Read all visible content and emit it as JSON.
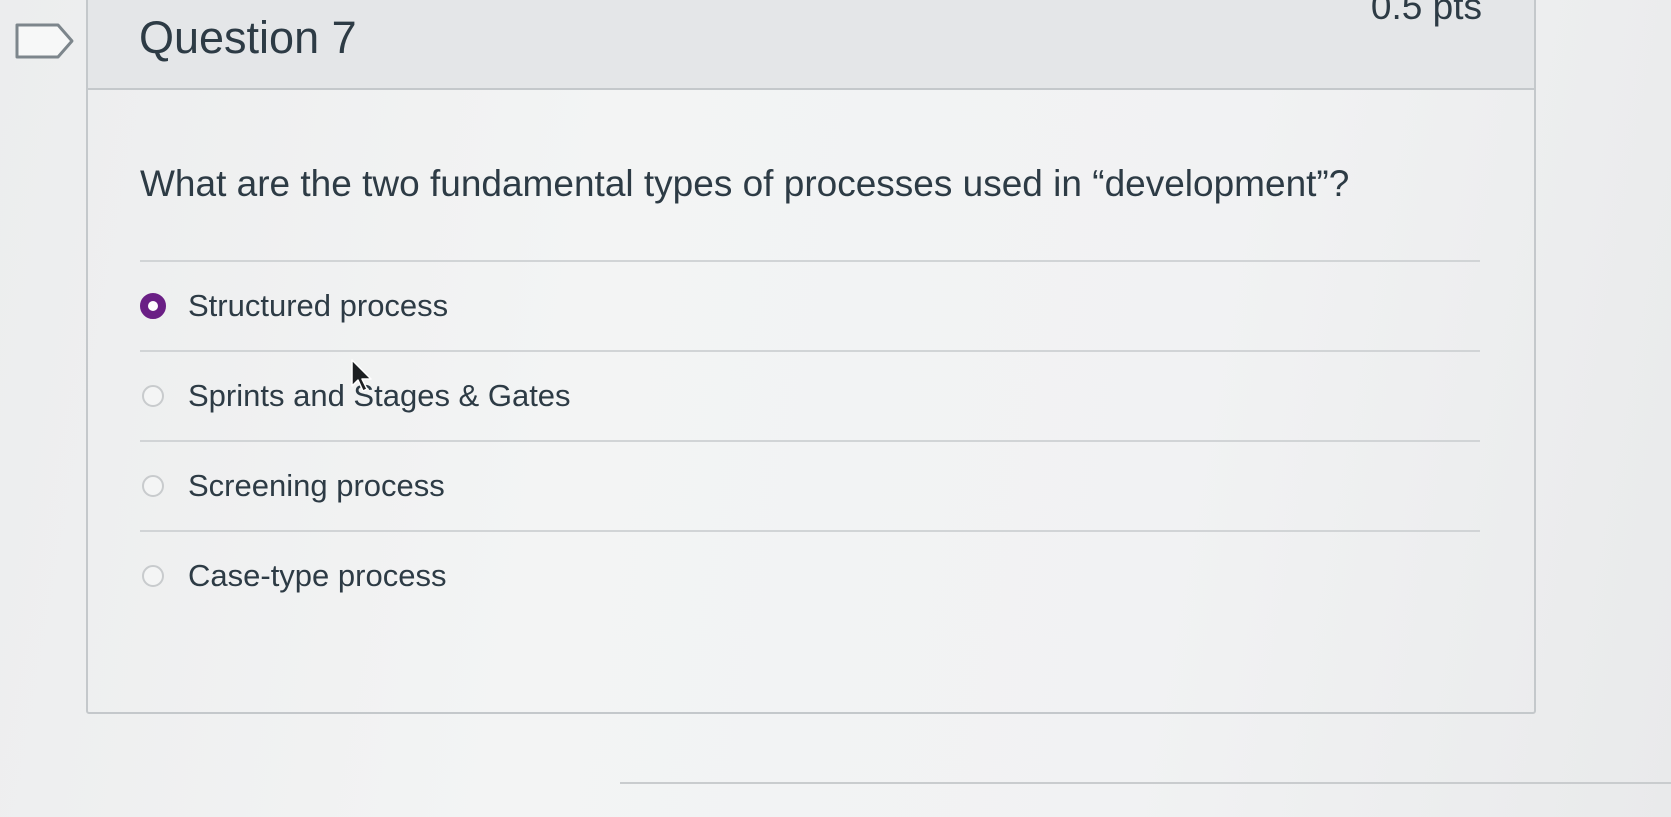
{
  "question": {
    "title": "Question 7",
    "points": "0.5 pts",
    "text": "What are the two fundamental types of processes used in “development”?"
  },
  "answers": [
    {
      "label": "Structured process",
      "selected": true
    },
    {
      "label": "Sprints and Stages & Gates",
      "selected": false
    },
    {
      "label": "Screening process",
      "selected": false
    },
    {
      "label": "Case-type process",
      "selected": false
    }
  ],
  "colors": {
    "selected_radio": "#6a1f85",
    "text": "#2d3b45",
    "header_bg": "#e4e6e8",
    "border": "#c4c8cb"
  },
  "icons": {
    "flag": "flag-question-icon",
    "cursor": "mouse-pointer-icon"
  }
}
